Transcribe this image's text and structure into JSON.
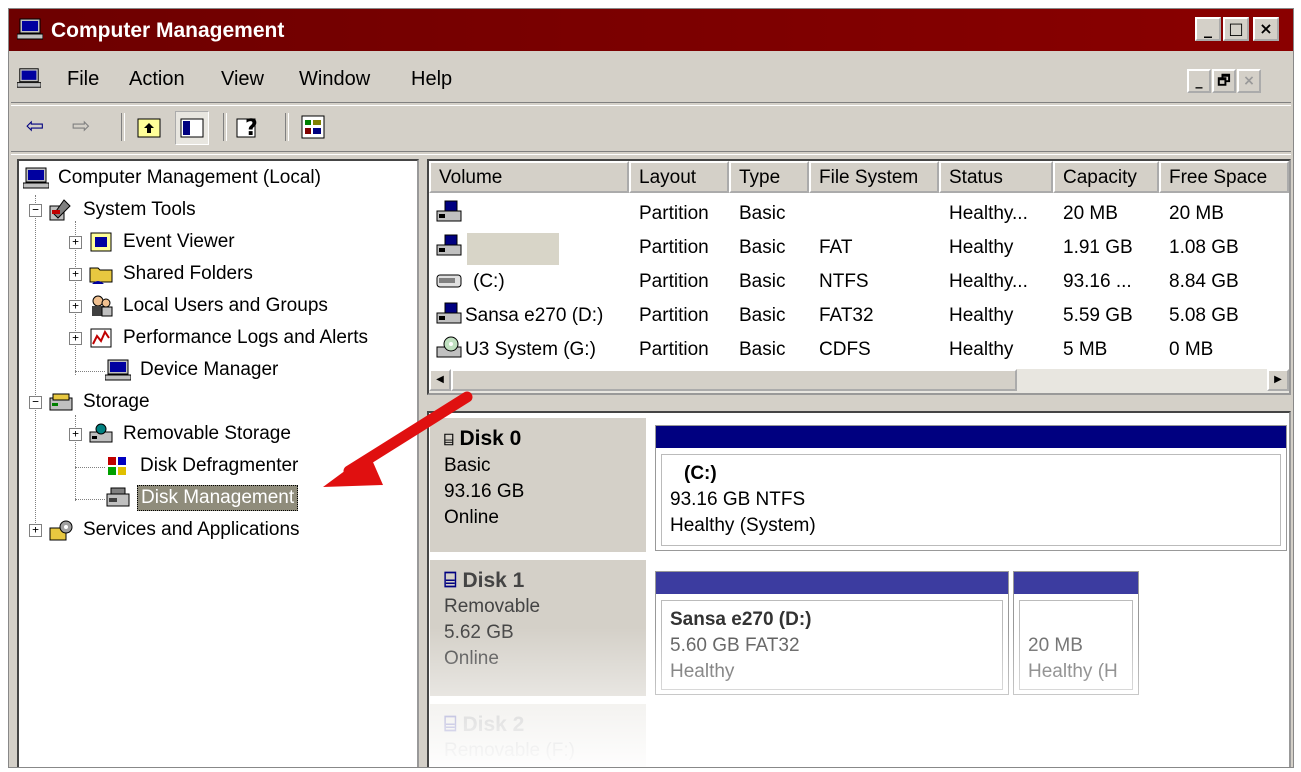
{
  "window": {
    "title": "Computer Management",
    "title_bar_color": "#800000",
    "caption_buttons": [
      "_",
      "□",
      "×"
    ],
    "mdi_buttons": [
      "_",
      "🗗",
      "×"
    ]
  },
  "menu": [
    "File",
    "Action",
    "View",
    "Window",
    "Help"
  ],
  "toolbar_icons": [
    "back-arrow-icon",
    "forward-arrow-icon",
    "up-folder-icon",
    "show-hide-tree-icon",
    "help-icon",
    "properties-icon"
  ],
  "tree": {
    "root": "Computer Management (Local)",
    "system_tools": "System Tools",
    "event_viewer": "Event Viewer",
    "shared_folders": "Shared Folders",
    "local_users": "Local Users and Groups",
    "perf_logs": "Performance Logs and Alerts",
    "device_manager": "Device Manager",
    "storage": "Storage",
    "removable_storage": "Removable Storage",
    "disk_defrag": "Disk Defragmenter",
    "disk_management": "Disk Management",
    "services": "Services and Applications"
  },
  "volumes": {
    "columns": [
      "Volume",
      "Layout",
      "Type",
      "File System",
      "Status",
      "Capacity",
      "Free Space"
    ],
    "rows": [
      {
        "volume": "",
        "layout": "Partition",
        "type": "Basic",
        "fs": "",
        "status": "Healthy...",
        "capacity": "20 MB",
        "free": "20 MB"
      },
      {
        "volume": "",
        "layout": "Partition",
        "type": "Basic",
        "fs": "FAT",
        "status": "Healthy",
        "capacity": "1.91 GB",
        "free": "1.08 GB"
      },
      {
        "volume": "(C:)",
        "layout": "Partition",
        "type": "Basic",
        "fs": "NTFS",
        "status": "Healthy...",
        "capacity": "93.16 ...",
        "free": "8.84 GB"
      },
      {
        "volume": "Sansa e270 (D:)",
        "layout": "Partition",
        "type": "Basic",
        "fs": "FAT32",
        "status": "Healthy",
        "capacity": "5.59 GB",
        "free": "5.08 GB"
      },
      {
        "volume": "U3 System (G:)",
        "layout": "Partition",
        "type": "Basic",
        "fs": "CDFS",
        "status": "Healthy",
        "capacity": "5 MB",
        "free": "0 MB"
      }
    ]
  },
  "disks": {
    "disk0": {
      "name": "Disk 0",
      "kind": "Basic",
      "size": "93.16 GB",
      "state": "Online",
      "part": {
        "name": "(C:)",
        "detail": "93.16 GB NTFS",
        "status": "Healthy (System)"
      }
    },
    "disk1": {
      "name": "Disk 1",
      "kind": "Removable",
      "size": "5.62 GB",
      "state": "Online",
      "part1": {
        "name": "Sansa e270  (D:)",
        "detail": "5.60 GB FAT32",
        "status": "Healthy"
      },
      "part2": {
        "detail": "20 MB",
        "status": "Healthy (H"
      }
    },
    "disk2": {
      "name": "Disk 2",
      "kind": "Removable (F:)"
    }
  },
  "colors": {
    "partition_primary": "#000080",
    "partition_removable": "#3c3ca0",
    "selection": "#8f8c7b",
    "annotation_arrow": "#e01010"
  }
}
